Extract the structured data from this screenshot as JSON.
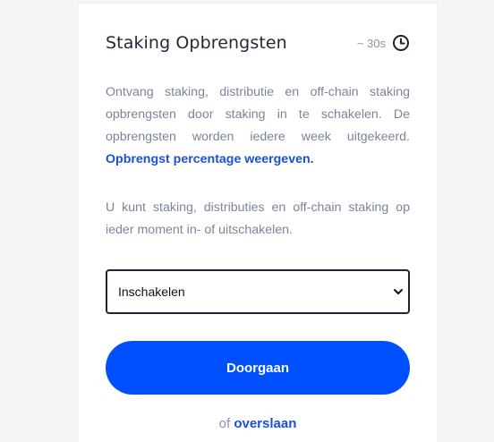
{
  "card": {
    "title": "Staking Opbrengsten",
    "timer": "~ 30s",
    "timer_icon": "clock-icon"
  },
  "intro": {
    "text": "Ontvang staking, distributie en off-chain staking opbrengsten door staking in te schakelen. De opbrengsten worden iedere week uitgekeerd.",
    "link_label": "Opbrengst percentage weergeven."
  },
  "info": {
    "text": "U kunt staking, distributies en off-chain staking op ieder moment in- of uitschakelen."
  },
  "select": {
    "value": "Inschakelen",
    "icon": "chevron-down-icon"
  },
  "actions": {
    "continue_label": "Doorgaan",
    "or_label": "of",
    "skip_label": "overslaan"
  },
  "colors": {
    "accent": "#0050ff",
    "link": "#1a4fd6",
    "text_muted": "#7a859b",
    "title": "#1e2a3b"
  }
}
